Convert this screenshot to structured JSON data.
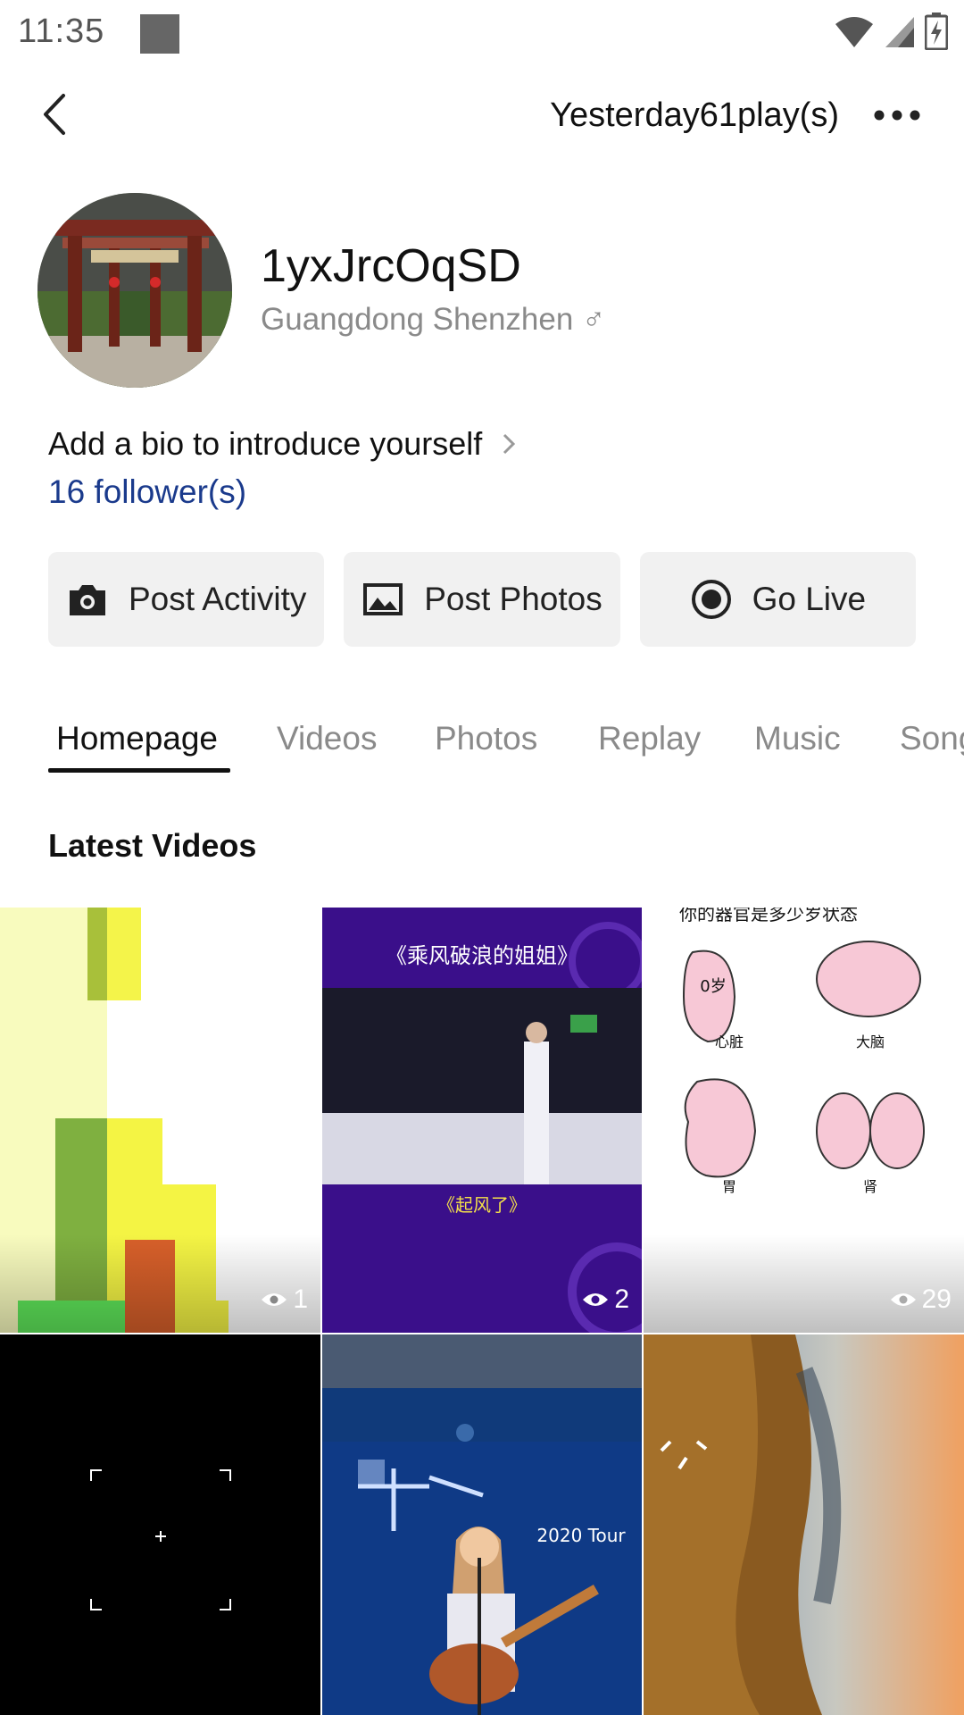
{
  "status_bar": {
    "time": "11:35"
  },
  "header": {
    "visits": "Yesterday61play(s)"
  },
  "profile": {
    "username": "1yxJrcOqSD",
    "location": "Guangdong Shenzhen ♂",
    "bio_prompt": "Add a bio to introduce yourself",
    "followers": "16 follower(s)"
  },
  "actions": [
    {
      "label": "Post Activity",
      "icon": "camera-icon"
    },
    {
      "label": "Post Photos",
      "icon": "image-icon"
    },
    {
      "label": "Go Live",
      "icon": "radio-button-icon"
    }
  ],
  "tabs": [
    "Homepage",
    "Videos",
    "Photos",
    "Replay",
    "Music",
    "Song"
  ],
  "active_tab": "Homepage",
  "section": {
    "title": "Latest Videos"
  },
  "videos": [
    {
      "views": "1",
      "thumb_text": ""
    },
    {
      "views": "2",
      "thumb_text": "《乘风破浪的姐姐》",
      "thumb_caption": "《起风了》"
    },
    {
      "views": "29",
      "thumb_text": "你的器官是多少岁状态",
      "labels": [
        "0岁",
        "心脏",
        "大脑",
        "胃",
        "肾"
      ]
    },
    {
      "views": ""
    },
    {
      "views": "",
      "thumb_text": "2020 Tour"
    },
    {
      "views": ""
    }
  ],
  "colors": {
    "link": "#1a3a8c",
    "button_bg": "#f1f1f1",
    "tile_purple": "#3a0f8a"
  }
}
